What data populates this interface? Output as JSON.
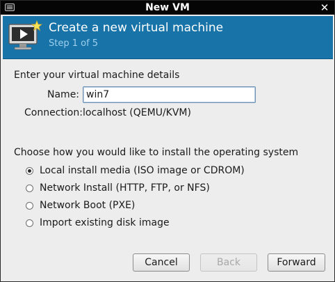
{
  "window": {
    "title": "New VM"
  },
  "banner": {
    "heading": "Create a new virtual machine",
    "step": "Step 1 of 5"
  },
  "details": {
    "section_label": "Enter your virtual machine details",
    "name_label": "Name:",
    "name_value": "win7",
    "connection_label": "Connection:",
    "connection_value": "localhost (QEMU/KVM)"
  },
  "install": {
    "section_label": "Choose how you would like to install the operating system",
    "selected": "local",
    "options": [
      {
        "id": "local",
        "label": "Local install media (ISO image or CDROM)"
      },
      {
        "id": "network-install",
        "label": "Network Install (HTTP, FTP, or NFS)"
      },
      {
        "id": "network-boot",
        "label": "Network Boot (PXE)"
      },
      {
        "id": "import",
        "label": "Import existing disk image"
      }
    ]
  },
  "buttons": {
    "cancel": "Cancel",
    "back": "Back",
    "back_enabled": false,
    "forward": "Forward"
  },
  "colors": {
    "banner_bg": "#1773a8",
    "banner_step": "#9fd0ee",
    "titlebar_bg": "#050505",
    "window_bg": "#ededed"
  }
}
